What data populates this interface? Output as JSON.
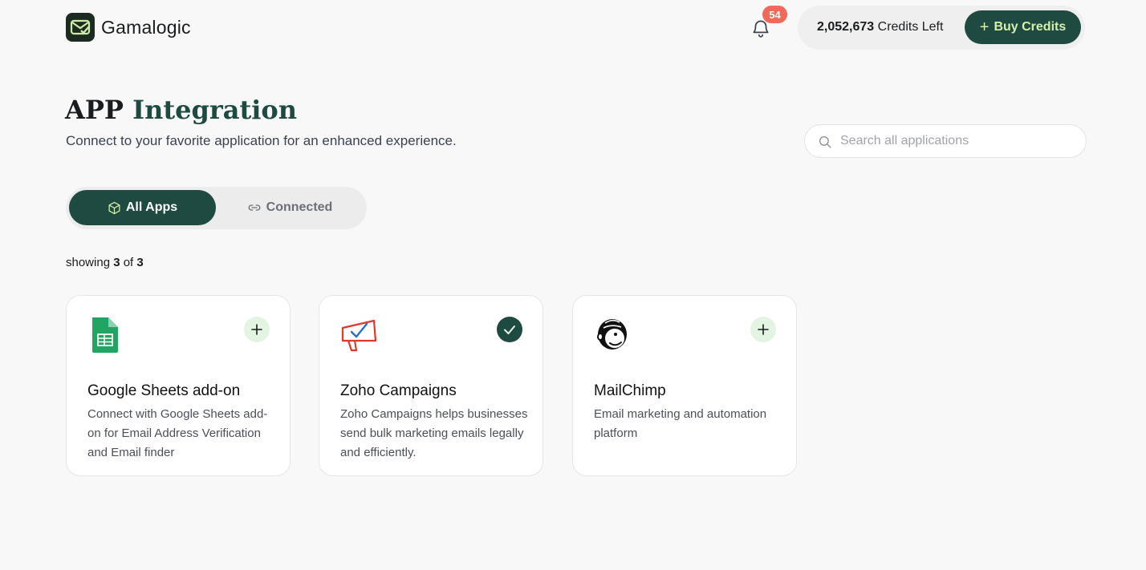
{
  "brand": {
    "name": "Gamalogic",
    "accent": "#1f4a42"
  },
  "header": {
    "notification_count": "54",
    "credits_amount": "2,052,673",
    "credits_label": " Credits Left",
    "buy_label": "Buy Credits",
    "buy_icon": "+"
  },
  "page": {
    "title_part1": "APP ",
    "title_part2": "Integration",
    "subtitle": "Connect to your favorite application for an enhanced experience."
  },
  "search": {
    "placeholder": "Search all applications",
    "value": ""
  },
  "tabs": [
    {
      "label": "All Apps",
      "icon": "cube-icon",
      "active": true
    },
    {
      "label": "Connected",
      "icon": "link-icon",
      "active": false
    }
  ],
  "showing": {
    "prefix": "showing ",
    "count": "3",
    "of": " of ",
    "total": "3"
  },
  "apps": [
    {
      "name": "Google Sheets add-on",
      "description": "Connect with Google Sheets add-on for Email Address Verification and Email finder",
      "icon": "google-sheets-icon",
      "status": "add"
    },
    {
      "name": "Zoho Campaigns",
      "description": "Zoho Campaigns helps businesses send bulk marketing emails legally and efficiently.",
      "icon": "zoho-campaigns-icon",
      "status": "connected"
    },
    {
      "name": "MailChimp",
      "description": "Email marketing and automation platform",
      "icon": "mailchimp-icon",
      "status": "add"
    }
  ]
}
